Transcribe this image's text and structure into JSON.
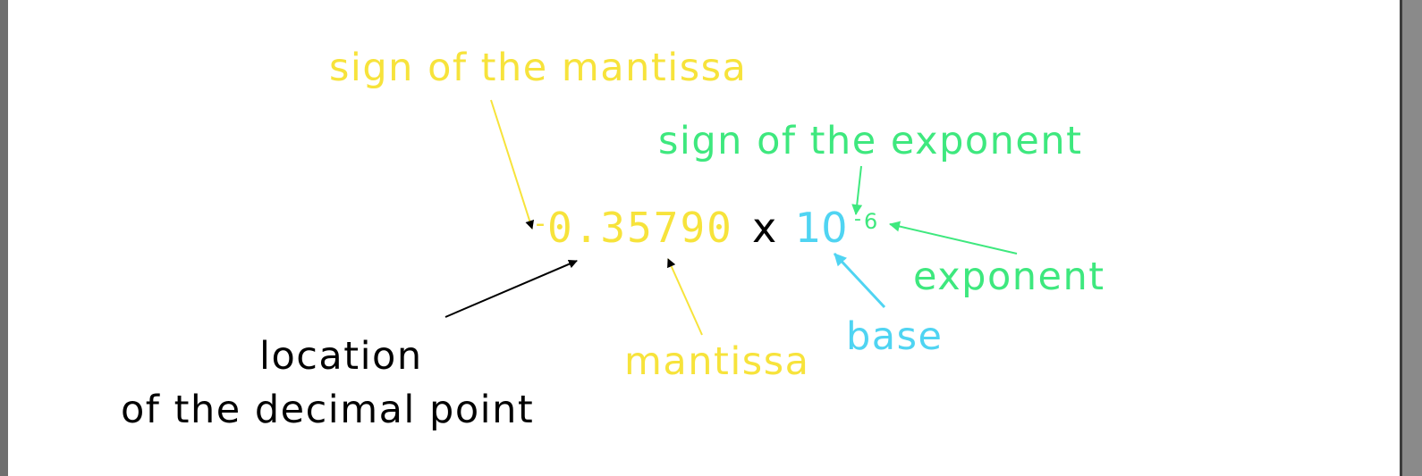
{
  "colors": {
    "yellow": "#f7e33b",
    "green": "#3ee87e",
    "cyan": "#4fd4f2",
    "black": "#000000"
  },
  "formula": {
    "sign": "-",
    "mantissa": "0.35790",
    "times": "x",
    "base": "10",
    "exponent_sign": "-",
    "exponent": "6"
  },
  "labels": {
    "sign_of_mantissa": "sign of the mantissa",
    "sign_of_exponent": "sign of the exponent",
    "exponent": "exponent",
    "base": "base",
    "mantissa": "mantissa",
    "decimal_point_line1": "location",
    "decimal_point_line2": "of the decimal point"
  }
}
